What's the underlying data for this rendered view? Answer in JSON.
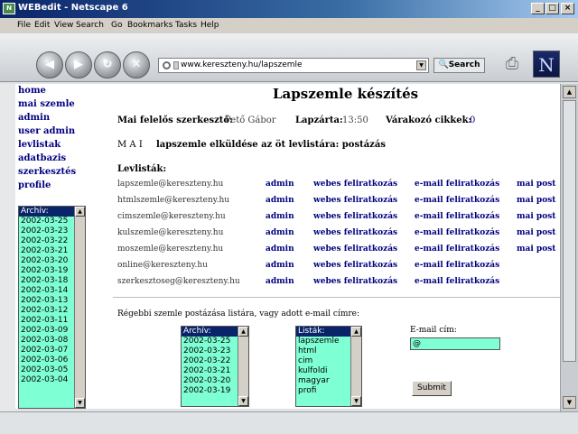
{
  "window": {
    "title": "WEBedit - Netscape 6",
    "icon": "netscape-app-icon",
    "btn_min": "_",
    "btn_max": "□",
    "btn_close": "×"
  },
  "menu": {
    "file": "File",
    "edit": "Edit",
    "view": "View",
    "search": "Search",
    "go": "Go",
    "bookmarks": "Bookmarks",
    "tasks": "Tasks",
    "help": "Help"
  },
  "toolbar": {
    "url": "www.kereszteny.hu/lapszemle",
    "search_label": "Search",
    "logo": "N"
  },
  "nav": [
    "home",
    "mai szemle",
    "admin",
    "user admin",
    "levlistak",
    "adatbazis",
    "szerkesztés",
    "profile"
  ],
  "sidebar_archive": [
    "Archív:",
    "2002-03-25",
    "2002-03-23",
    "2002-03-22",
    "2002-03-21",
    "2002-03-20",
    "2002-03-19",
    "2002-03-18",
    "2002-03-14",
    "2002-03-13",
    "2002-03-12",
    "2002-03-11",
    "2002-03-09",
    "2002-03-08",
    "2002-03-07",
    "2002-03-06",
    "2002-03-05",
    "2002-03-04"
  ],
  "main": {
    "title": "Lapszemle készítés",
    "editor_label": "Mai felelős szerkesztő:",
    "editor_value": "Pető Gábor",
    "deadline_label": "Lapzárta:",
    "deadline_value": "13:50",
    "pending_label": "Várakozó cikkek:",
    "pending_value": "0",
    "send_prefix": "M A I",
    "send_text": "lapszemle elküldése az öt levlistára: postázás",
    "lists_heading": "Levlisták:",
    "col_admin": "admin",
    "col_web": "webes feliratkozás",
    "col_email": "e-mail feliratkozás",
    "col_post": "mai post",
    "lists": [
      {
        "email": "lapszemle@kereszteny.hu",
        "post": true
      },
      {
        "email": "htmlszemle@kereszteny.hu",
        "post": true
      },
      {
        "email": "cimszemle@kereszteny.hu",
        "post": true
      },
      {
        "email": "kulszemle@kereszteny.hu",
        "post": true
      },
      {
        "email": "moszemle@kereszteny.hu",
        "post": true
      },
      {
        "email": "online@kereszteny.hu",
        "post": false
      },
      {
        "email": "szerkesztoseg@kereszteny.hu",
        "post": false
      }
    ],
    "resend_text": "Régebbi szemle postázása listára, vagy adott e-mail címre:",
    "archive_list": [
      "Archív:",
      "2002-03-25",
      "2002-03-23",
      "2002-03-22",
      "2002-03-21",
      "2002-03-20",
      "2002-03-19"
    ],
    "lists_list": [
      "Listák:",
      "lapszemle",
      "html",
      "cim",
      "kulfoldi",
      "magyar",
      "profi"
    ],
    "email_label": "E-mail cím:",
    "email_value": "@",
    "submit": "Submit"
  }
}
